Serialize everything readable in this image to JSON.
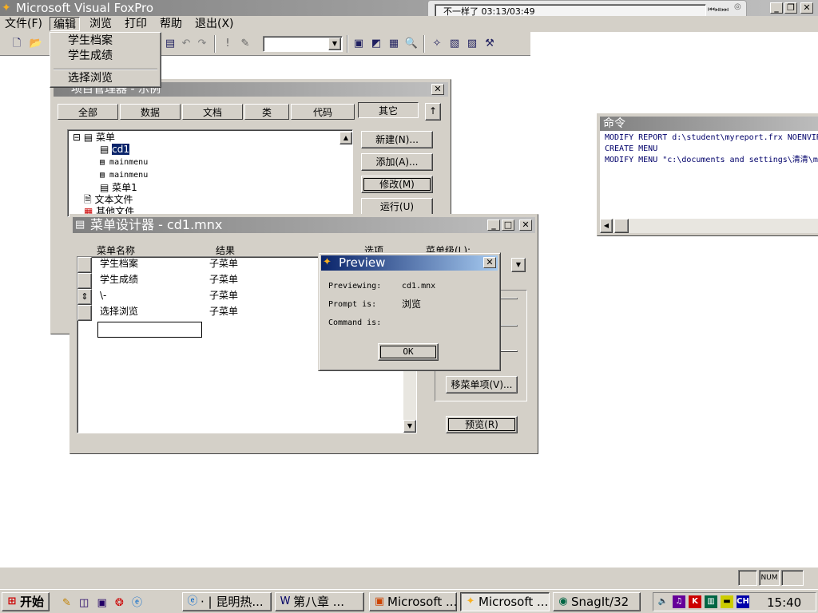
{
  "app": {
    "title": "Microsoft Visual FoxPro"
  },
  "menubar": [
    {
      "label": "文件(F)"
    },
    {
      "label": "编辑"
    },
    {
      "label": "浏览"
    },
    {
      "label": "打印"
    },
    {
      "label": "帮助"
    },
    {
      "label": "退出(X)"
    }
  ],
  "edit_dropdown": [
    "学生档案",
    "学生成绩",
    "选择浏览"
  ],
  "media_player": {
    "status": "不一样了 03:13/03:49"
  },
  "project_manager": {
    "title": "项目管理器 - 示例",
    "tabs": [
      "全部",
      "数据",
      "文档",
      "类",
      "代码",
      "其它"
    ],
    "tree": {
      "root": "菜单",
      "children": [
        "cd1",
        "mainmenu",
        "mainmenu",
        "菜单1"
      ],
      "siblings": [
        "文本文件",
        "其他文件"
      ]
    },
    "buttons": [
      "新建(N)...",
      "添加(A)...",
      "修改(M)",
      "运行(U)"
    ]
  },
  "command_window": {
    "title": "命令",
    "lines": [
      "MODIFY REPORT d:\\student\\myreport.frx NOENVIR",
      "CREATE MENU",
      "MODIFY MENU \"c:\\documents and settings\\清清\\m"
    ]
  },
  "menu_designer": {
    "title": "菜单设计器 - cd1.mnx",
    "columns": {
      "name": "菜单名称",
      "result": "结果",
      "options": "选项",
      "level": "菜单级(L):"
    },
    "rows": [
      {
        "name": "学生档案",
        "result": "子菜单"
      },
      {
        "name": "学生成绩",
        "result": "子菜单"
      },
      {
        "name": "\\-",
        "result": "子菜单"
      },
      {
        "name": "选择浏览",
        "result": "子菜单"
      }
    ],
    "buttons": {
      "remove": "移菜单项(V)...",
      "preview": "预览(R)"
    }
  },
  "preview_dialog": {
    "title": "Preview",
    "labels": [
      "Previewing:",
      "Prompt is:",
      "Command is:"
    ],
    "values": [
      "cd1.mnx",
      "浏览",
      ""
    ],
    "ok": "OK"
  },
  "statusbar": {
    "num": "NUM"
  },
  "taskbar": {
    "start": "开始",
    "tasks": [
      "· | 昆明热...",
      "第八章 ...",
      "Microsoft ...",
      "Microsoft ...",
      "SnagIt/32"
    ],
    "active_index": 3,
    "clock": "15:40",
    "lang": "CH"
  }
}
